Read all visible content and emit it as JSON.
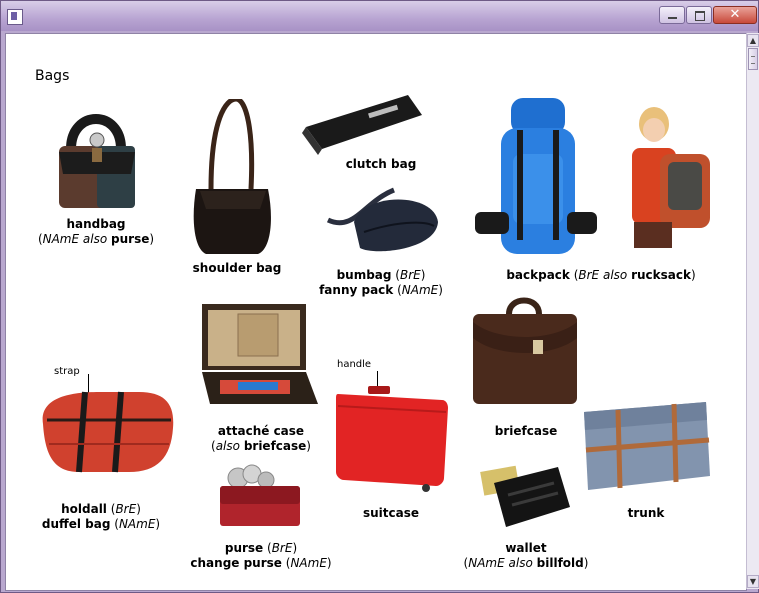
{
  "window": {
    "icons": {
      "app": "app-icon",
      "minimize": "minimize-icon",
      "maximize": "maximize-icon",
      "close": "close-icon",
      "close_glyph": "✕"
    }
  },
  "scrollbar": {
    "up": "▲",
    "down": "▼"
  },
  "page": {
    "heading": "Bags"
  },
  "items": {
    "handbag": {
      "name": "handbag",
      "open": "(",
      "region": "NAmE",
      "also": "also",
      "alt": "purse",
      "close": ")"
    },
    "shoulder_bag": {
      "name": "shoulder bag"
    },
    "clutch_bag": {
      "name": "clutch bag"
    },
    "bumbag": {
      "name": "bumbag",
      "region1": "BrE",
      "name2": "fanny pack",
      "region2": "NAmE"
    },
    "backpack": {
      "name": "backpack",
      "region": "BrE",
      "also": "also",
      "alt": "rucksack"
    },
    "holdall": {
      "name": "holdall",
      "region1": "BrE",
      "name2": "duffel bag",
      "region2": "NAmE",
      "callout": "strap"
    },
    "attache_case": {
      "name": "attaché case",
      "also": "also",
      "alt": "briefcase"
    },
    "suitcase": {
      "name": "suitcase",
      "callout": "handle"
    },
    "briefcase": {
      "name": "briefcase"
    },
    "trunk": {
      "name": "trunk"
    },
    "purse": {
      "name": "purse",
      "region1": "BrE",
      "name2": "change purse",
      "region2": "NAmE"
    },
    "wallet": {
      "name": "wallet",
      "region": "NAmE",
      "also": "also",
      "alt": "billfold"
    }
  }
}
